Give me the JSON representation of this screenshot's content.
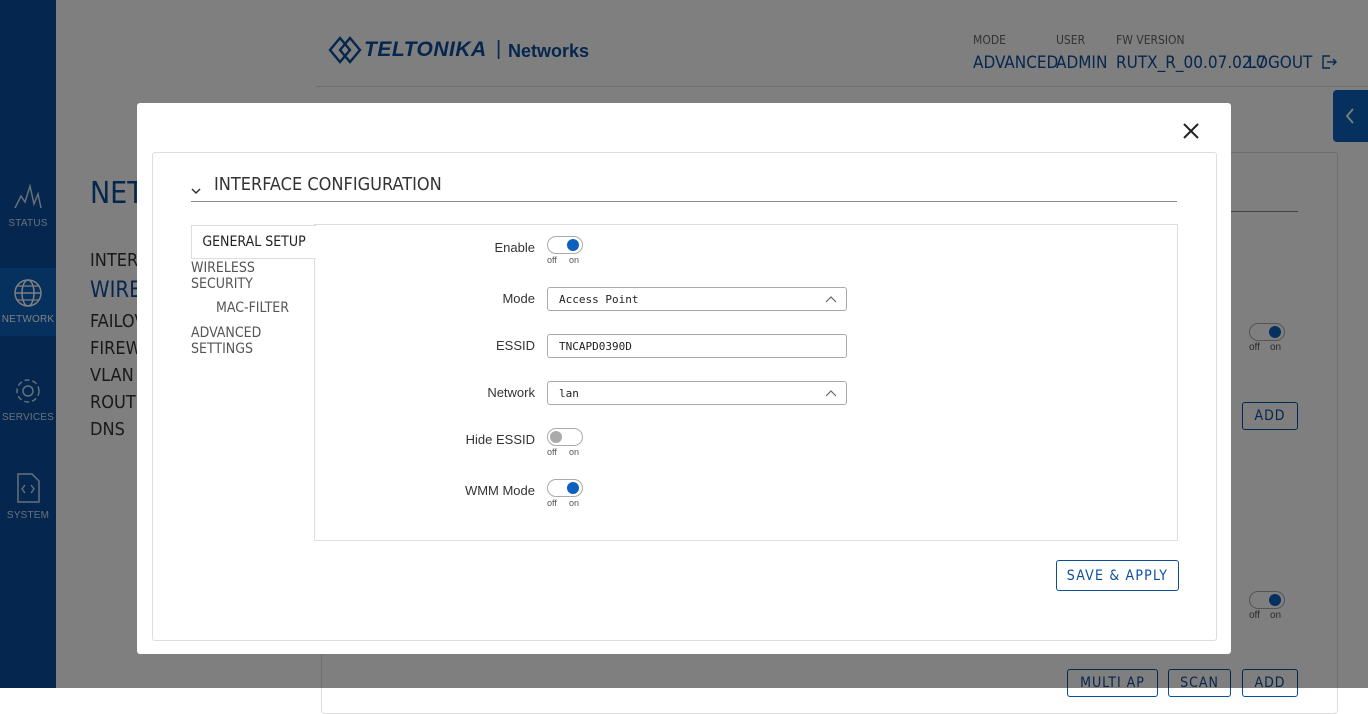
{
  "header": {
    "logo_brand": "TELTONIKA",
    "logo_sub": "Networks",
    "mode_label": "MODE",
    "mode_value": "ADVANCED",
    "user_label": "USER",
    "user_value": "ADMIN",
    "fw_label": "FW VERSION",
    "fw_value": "RUTX_R_00.07.02.7",
    "logout": "LOGOUT"
  },
  "sidebar": {
    "items": [
      {
        "label": "STATUS",
        "icon": "status-chart-icon"
      },
      {
        "label": "NETWORK",
        "icon": "globe-icon"
      },
      {
        "label": "SERVICES",
        "icon": "gear-icon"
      },
      {
        "label": "SYSTEM",
        "icon": "code-file-icon"
      }
    ]
  },
  "subnav": {
    "title": "NETW",
    "items": [
      "INTERFA",
      "WIREL",
      "FAILOV",
      "FIREWA",
      "VLAN",
      "ROUTIN",
      "DNS"
    ]
  },
  "background": {
    "toggle_off": "off",
    "toggle_on": "on",
    "add": "ADD",
    "multi_ap": "MULTI AP",
    "scan": "SCAN"
  },
  "modal": {
    "section_title": "INTERFACE CONFIGURATION",
    "tabs": [
      "GENERAL SETUP",
      "WIRELESS SECURITY",
      "MAC-FILTER",
      "ADVANCED SETTINGS"
    ],
    "fields": {
      "enable_label": "Enable",
      "mode_label": "Mode",
      "mode_value": "Access Point",
      "essid_label": "ESSID",
      "essid_value": "TNCAPD0390D",
      "network_label": "Network",
      "network_value": "lan",
      "hide_essid_label": "Hide ESSID",
      "wmm_label": "WMM Mode",
      "off": "off",
      "on": "on"
    },
    "save_apply": "SAVE & APPLY"
  },
  "colors": {
    "brand_blue": "#0a4d9c",
    "accent_blue": "#0d60bd"
  }
}
